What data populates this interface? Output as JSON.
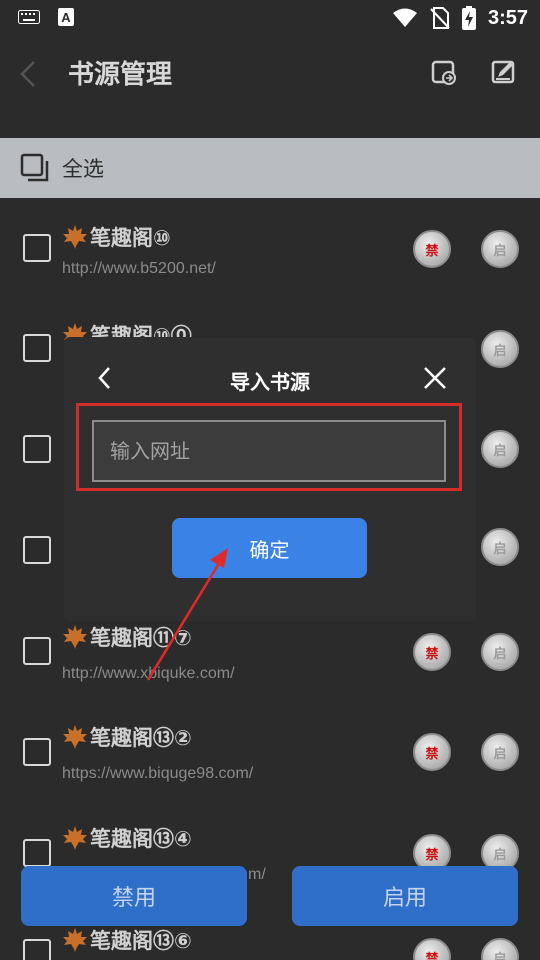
{
  "status_bar": {
    "time": "3:57",
    "icons": [
      "keyboard-icon",
      "a-badge-icon",
      "wifi-icon",
      "no-sim-icon",
      "battery-charging-icon"
    ]
  },
  "header": {
    "title": "书源管理",
    "icons": [
      "back-arrow-icon",
      "import-icon",
      "edit-icon"
    ]
  },
  "select_all": {
    "label": "全选"
  },
  "sources": [
    {
      "name": "笔趣阁⑩",
      "url": "http://www.b5200.net/"
    },
    {
      "name": "笔趣阁⑩⓪",
      "url": ""
    },
    {
      "name": "",
      "url": ""
    },
    {
      "name": "",
      "url": ""
    },
    {
      "name": "笔趣阁⑪⑦",
      "url": "http://www.xbiquke.com/"
    },
    {
      "name": "笔趣阁⑬②",
      "url": "https://www.biquge98.com/"
    },
    {
      "name": "笔趣阁⑬④",
      "url": "m/"
    },
    {
      "name": "笔趣阁⑬⑥",
      "url": ""
    }
  ],
  "coin_labels": {
    "ban": "禁",
    "on": "启"
  },
  "dialog": {
    "title": "导入书源",
    "input_placeholder": "输入网址",
    "input_value": "",
    "confirm_label": "确定"
  },
  "bottom": {
    "ban_label": "禁用",
    "enable_label": "启用"
  },
  "colors": {
    "accent": "#3b82e6",
    "highlight_box": "#d42b2b",
    "ban_text": "#cc1010"
  }
}
